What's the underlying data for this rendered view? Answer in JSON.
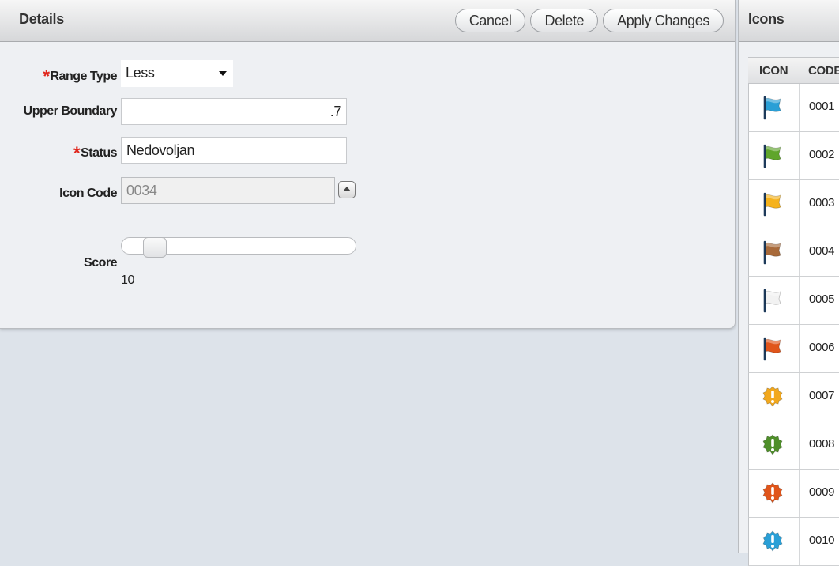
{
  "details": {
    "title": "Details",
    "buttons": {
      "cancel": "Cancel",
      "delete": "Delete",
      "apply": "Apply Changes"
    },
    "fields": {
      "range_type": {
        "label": "Range Type",
        "required": "*",
        "value": "Less"
      },
      "upper_boundary": {
        "label": "Upper Boundary",
        "value": ".7"
      },
      "status": {
        "label": "Status",
        "required": "*",
        "value": "Nedovoljan"
      },
      "icon_code": {
        "label": "Icon Code",
        "value": "0034"
      },
      "score": {
        "label": "Score",
        "value": "10",
        "slider_fraction": 0.1
      }
    }
  },
  "icons_panel": {
    "title": "Icons",
    "columns": [
      "ICON",
      "CODE"
    ],
    "rows": [
      {
        "code": "0001",
        "icon": "flag-icon",
        "color": "#2a9fd6"
      },
      {
        "code": "0002",
        "icon": "flag-icon",
        "color": "#5fa52b"
      },
      {
        "code": "0003",
        "icon": "flag-icon",
        "color": "#f5b21c"
      },
      {
        "code": "0004",
        "icon": "flag-icon",
        "color": "#a86a3a"
      },
      {
        "code": "0005",
        "icon": "flag-icon",
        "color": "#f2f2f2"
      },
      {
        "code": "0006",
        "icon": "flag-icon",
        "color": "#e0551b"
      },
      {
        "code": "0007",
        "icon": "alert-badge-icon",
        "color": "#f2a81d"
      },
      {
        "code": "0008",
        "icon": "alert-badge-icon",
        "color": "#4f8f2a"
      },
      {
        "code": "0009",
        "icon": "alert-badge-icon",
        "color": "#e0551b"
      },
      {
        "code": "0010",
        "icon": "alert-badge-icon",
        "color": "#2a9fd6"
      }
    ]
  }
}
